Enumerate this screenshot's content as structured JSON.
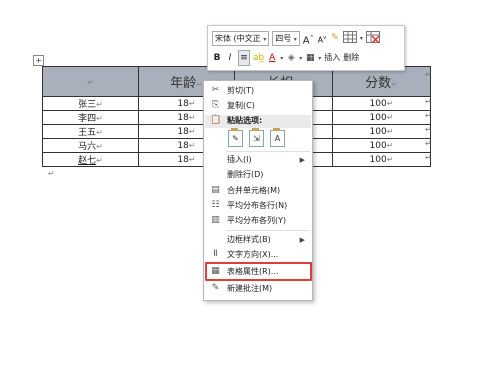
{
  "table": {
    "headers": [
      "",
      "年龄",
      "长相",
      "分数"
    ],
    "rows": [
      {
        "name": "张三",
        "age": "18",
        "looks": "",
        "score": "100"
      },
      {
        "name": "李四",
        "age": "18",
        "looks": "",
        "score": "100"
      },
      {
        "name": "王五",
        "age": "18",
        "looks": "",
        "score": "100"
      },
      {
        "name": "马六",
        "age": "18",
        "looks": "",
        "score": "100"
      },
      {
        "name": "赵七",
        "age": "18",
        "looks": "",
        "score": "100"
      }
    ],
    "para_mark": "↵",
    "move_handle": "+"
  },
  "mini_toolbar": {
    "font_name": "宋体 (中文正",
    "font_size": "四号",
    "grow_font": "A",
    "shrink_font": "A",
    "format_painter_icon": "paintbrush-icon",
    "table_icon": "table-icon",
    "delete_icon": "delete-table-icon",
    "bold": "B",
    "italic": "I",
    "align_center_icon": "align-center-icon",
    "highlight_icon": "highlight-icon",
    "font_color": "A",
    "shading_icon": "shading-icon",
    "borders_icon": "borders-icon",
    "insert": "插入",
    "delete": "删除"
  },
  "context_menu": {
    "cut": "剪切(T)",
    "copy": "复制(C)",
    "paste_options": "粘贴选项:",
    "insert": "插入(I)",
    "delete_row": "删除行(D)",
    "merge_cells": "合并单元格(M)",
    "distribute_rows": "平均分布各行(N)",
    "distribute_cols": "平均分布各列(Y)",
    "border_styles": "边框样式(B)",
    "text_direction": "文字方向(X)...",
    "table_properties": "表格属性(R)...",
    "new_comment": "新建批注(M)"
  },
  "colors": {
    "header_fill": "#a9b0bb",
    "highlight_box": "#e23b3b",
    "menu_border": "#b7b7b7"
  }
}
